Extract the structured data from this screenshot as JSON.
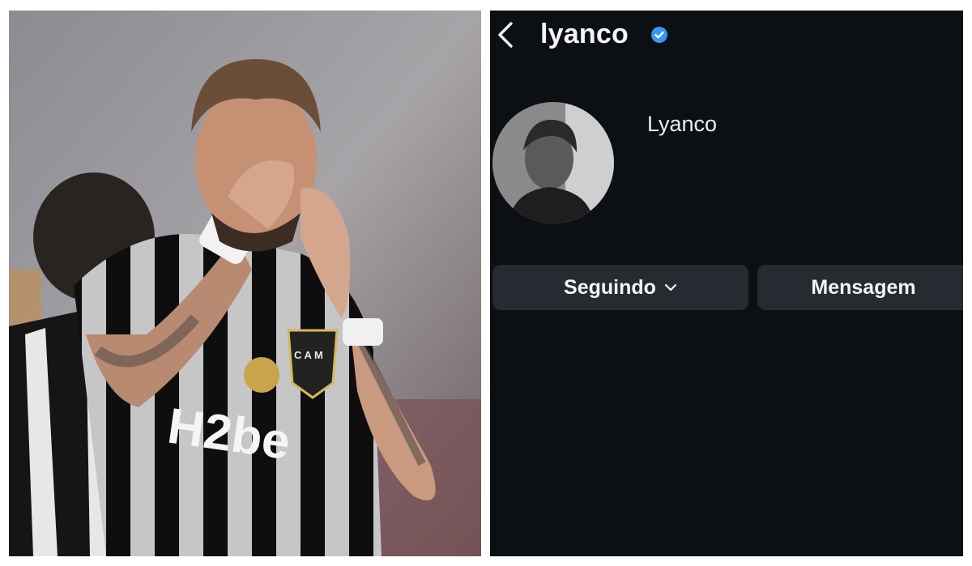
{
  "photo": {
    "jersey_text": "H2be",
    "crest_text": "C A M"
  },
  "profile": {
    "username": "lyanco",
    "display_name": "Lyanco",
    "follow_button_label": "Seguindo",
    "message_button_label": "Mensagem"
  },
  "colors": {
    "background": "#0c0f14",
    "button": "#262a31",
    "verified_blue": "#3897f0"
  },
  "icons": {
    "back": "chevron-left-icon",
    "verified": "verified-badge-icon",
    "dropdown": "chevron-down-icon"
  }
}
